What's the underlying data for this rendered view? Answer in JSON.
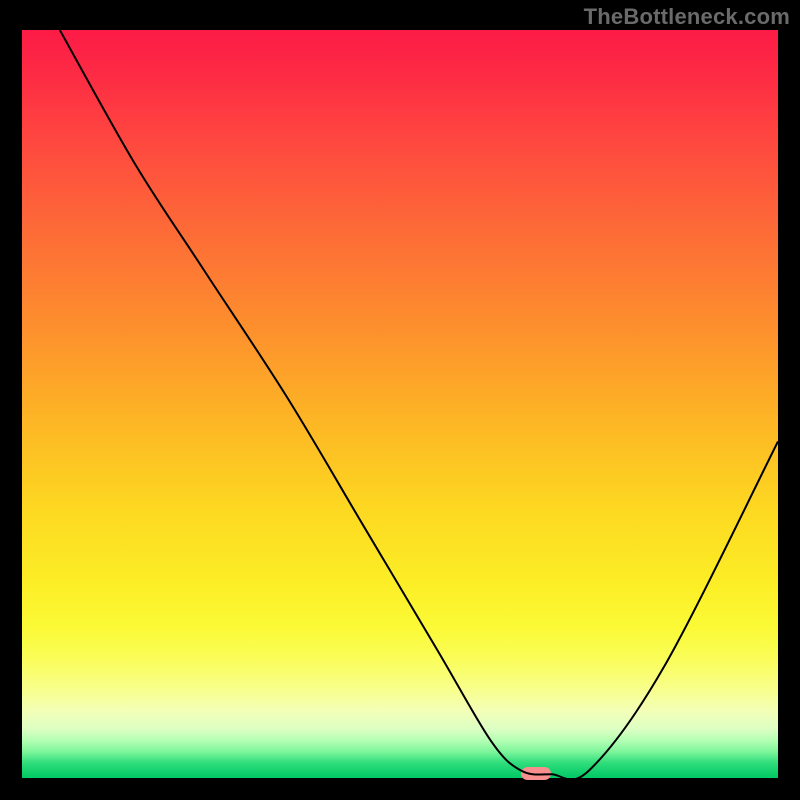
{
  "watermark": "TheBottleneck.com",
  "chart_data": {
    "type": "line",
    "title": "",
    "xlabel": "",
    "ylabel": "",
    "xlim": [
      0,
      100
    ],
    "ylim": [
      0,
      100
    ],
    "grid": false,
    "legend": false,
    "background": "heatmap-gradient-red-yellow-green",
    "series": [
      {
        "name": "bottleneck-curve",
        "x": [
          5,
          15,
          24,
          35,
          45,
          55,
          62,
          66,
          70,
          75,
          85,
          100
        ],
        "y": [
          100,
          82,
          68,
          51,
          34,
          17,
          5,
          1,
          0.5,
          1,
          15,
          45
        ]
      }
    ],
    "marker": {
      "name": "optimal-point",
      "x": 68,
      "y": 0.5,
      "color": "#f88f8e"
    }
  }
}
